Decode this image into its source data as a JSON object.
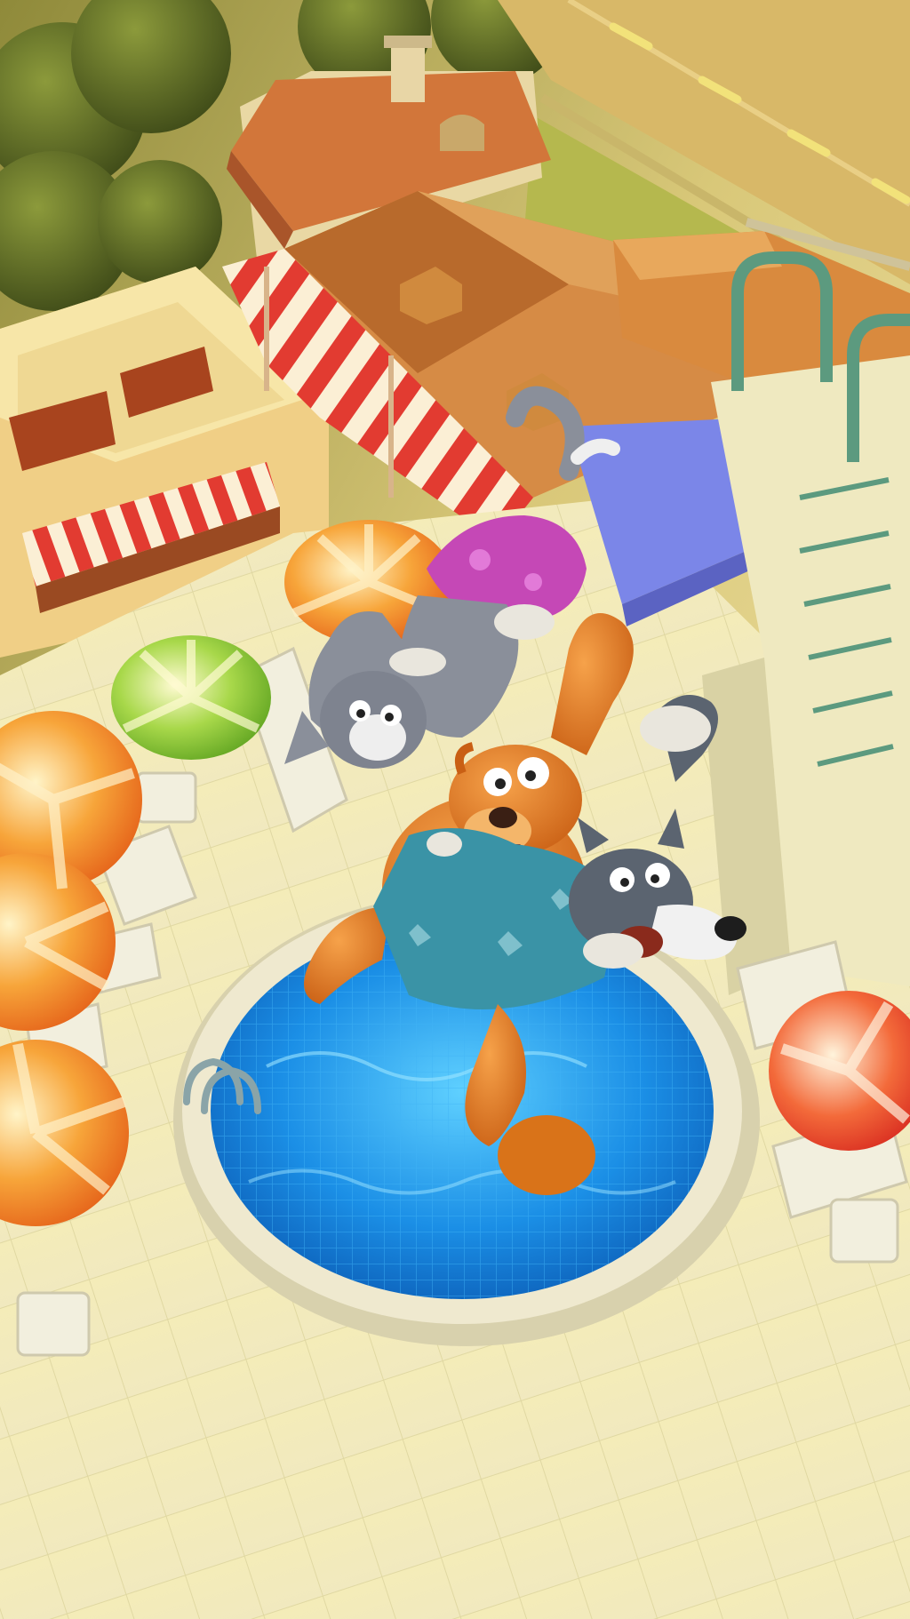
{
  "scene": {
    "title": "",
    "colors": {
      "sky_glow": "#f6d89a",
      "lawn": "#b5b84e",
      "road": "#d8b868",
      "road_marking": "#f2e27a",
      "roof": "#d2763a",
      "roof_dark": "#a9552a",
      "wall": "#f0dc9c",
      "deck_tile": "#f4f0c4",
      "deck_grout": "#e1dba7",
      "pool_rim": "#efe9cf",
      "pool_water": "#1b8fe6",
      "pool_water_light": "#4cc2fb",
      "stripe_red": "#e23b31",
      "stripe_cream": "#fbefd5",
      "umbrella_orange": "#f7931e",
      "umbrella_green": "#7bbf2e",
      "diving_board": "#7b86e8",
      "bear_fur": "#e07a22",
      "bear_shorts": "#3a93a6",
      "cat_fur": "#8a8f9a",
      "cat_shorts": "#c548b6",
      "wolf_fur": "#5b6470"
    },
    "characters": [
      {
        "name": "bear",
        "icon": "bear-character"
      },
      {
        "name": "cat",
        "icon": "cat-character"
      },
      {
        "name": "wolf",
        "icon": "wolf-character"
      }
    ],
    "props": [
      "pool",
      "diving-board",
      "pool-ladder",
      "umbrellas",
      "sun-loungers",
      "houses",
      "trees",
      "road",
      "snack-kiosk",
      "windbreak-fence"
    ]
  }
}
